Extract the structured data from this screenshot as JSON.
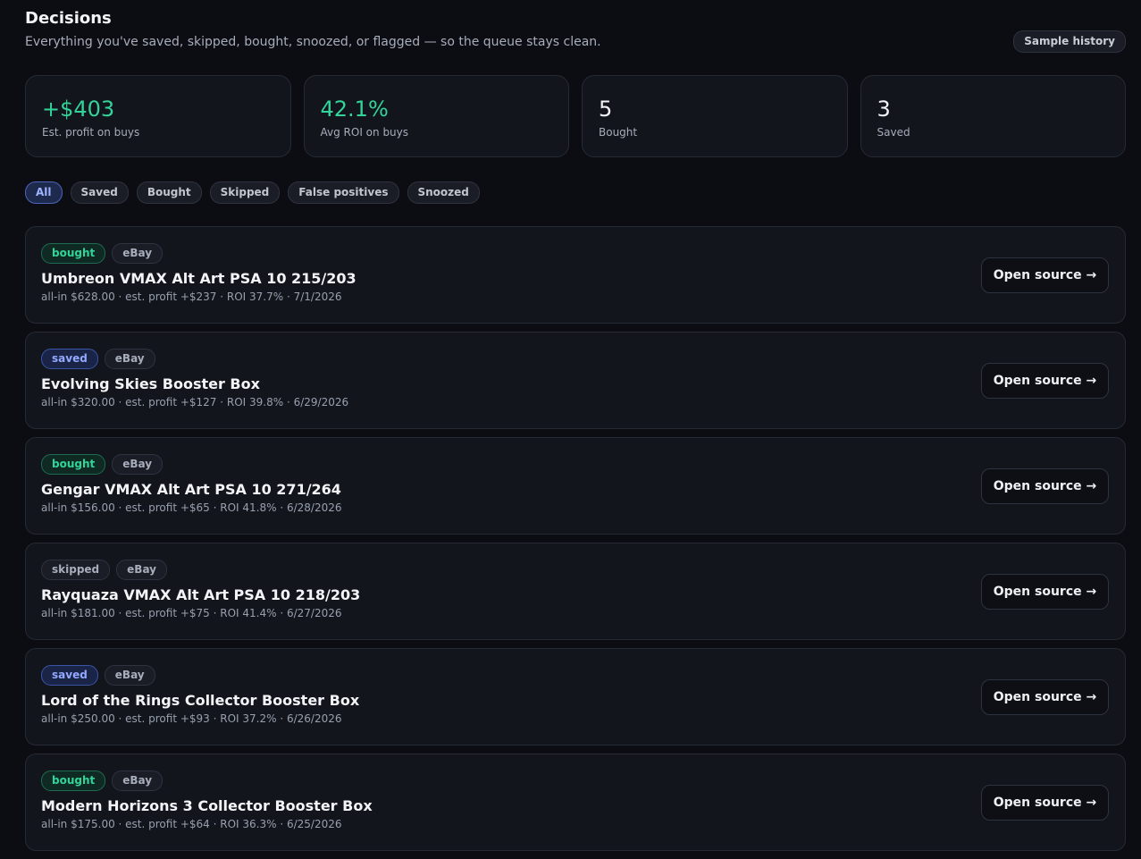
{
  "header": {
    "title": "Decisions",
    "subtitle": "Everything you've saved, skipped, bought, snoozed, or flagged — so the queue stays clean.",
    "sample_button": "Sample history"
  },
  "stats": [
    {
      "value": "+$403",
      "label": "Est. profit on buys",
      "color": "#34d399"
    },
    {
      "value": "42.1%",
      "label": "Avg ROI on buys",
      "color": "#34d399"
    },
    {
      "value": "5",
      "label": "Bought"
    },
    {
      "value": "3",
      "label": "Saved"
    }
  ],
  "filters": [
    {
      "label": "All",
      "active": true
    },
    {
      "label": "Saved"
    },
    {
      "label": "Bought"
    },
    {
      "label": "Skipped"
    },
    {
      "label": "False positives"
    },
    {
      "label": "Snoozed"
    }
  ],
  "open_source_label": "Open source →",
  "items": [
    {
      "status": "bought",
      "source": "eBay",
      "title": "Umbreon VMAX Alt Art PSA 10 215/203",
      "meta": "all-in $628.00 · est. profit +$237 · ROI 37.7% · 7/1/2026"
    },
    {
      "status": "saved",
      "source": "eBay",
      "title": "Evolving Skies Booster Box",
      "meta": "all-in $320.00 · est. profit +$127 · ROI 39.8% · 6/29/2026"
    },
    {
      "status": "bought",
      "source": "eBay",
      "title": "Gengar VMAX Alt Art PSA 10 271/264",
      "meta": "all-in $156.00 · est. profit +$65 · ROI 41.8% · 6/28/2026"
    },
    {
      "status": "skipped",
      "source": "eBay",
      "title": "Rayquaza VMAX Alt Art PSA 10 218/203",
      "meta": "all-in $181.00 · est. profit +$75 · ROI 41.4% · 6/27/2026"
    },
    {
      "status": "saved",
      "source": "eBay",
      "title": "Lord of the Rings Collector Booster Box",
      "meta": "all-in $250.00 · est. profit +$93 · ROI 37.2% · 6/26/2026"
    },
    {
      "status": "bought",
      "source": "eBay",
      "title": "Modern Horizons 3 Collector Booster Box",
      "meta": "all-in $175.00 · est. profit +$64 · ROI 36.3% · 6/25/2026"
    }
  ]
}
